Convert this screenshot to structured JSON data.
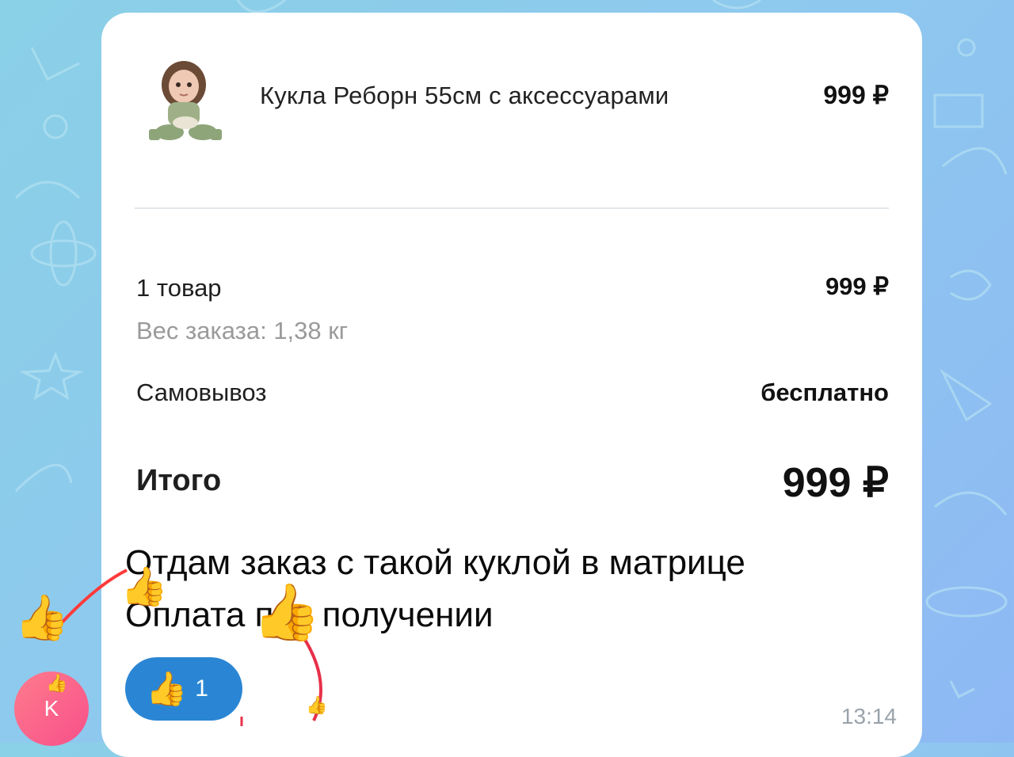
{
  "product": {
    "name": "Кукла Реборн 55см с аксессуарами",
    "price": "999 ₽"
  },
  "summary": {
    "items_label": "1 товар",
    "items_value": "999 ₽",
    "weight_label": "Вес заказа: 1,38 кг",
    "delivery_label": "Самовывоз",
    "delivery_value": "бесплатно",
    "total_label": "Итого",
    "total_value": "999 ₽"
  },
  "message": {
    "line1": "Отдам заказ с такой куклой в матрице",
    "line2": "Оплата при получении",
    "time": "13:14"
  },
  "reaction": {
    "emoji": "👍",
    "count": "1"
  },
  "avatar": {
    "initial": "K"
  },
  "colors": {
    "reaction_bg": "#2a86d4",
    "avatar_bg": "#f7508a",
    "wallpaper": "#8ec9ee"
  }
}
